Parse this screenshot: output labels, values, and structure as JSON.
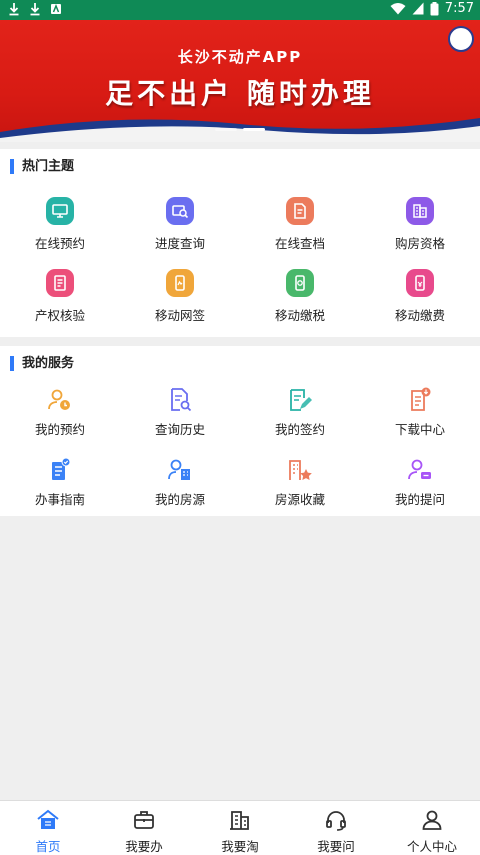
{
  "status_bar": {
    "time": "7:57"
  },
  "banner": {
    "subtitle": "长沙不动产APP",
    "title": "足不出户  随时办理"
  },
  "hot_topics": {
    "title": "热门主题",
    "items": [
      {
        "label": "在线预约",
        "icon": "calendar-screen-icon",
        "color": "#27b3a6"
      },
      {
        "label": "进度查询",
        "icon": "search-progress-icon",
        "color": "#6a6ef0"
      },
      {
        "label": "在线查档",
        "icon": "document-search-icon",
        "color": "#ec7b5c"
      },
      {
        "label": "购房资格",
        "icon": "building-qualification-icon",
        "color": "#8d5ae8"
      },
      {
        "label": "产权核验",
        "icon": "property-verify-icon",
        "color": "#ec4f7a"
      },
      {
        "label": "移动网签",
        "icon": "mobile-sign-icon",
        "color": "#f0a63a"
      },
      {
        "label": "移动缴税",
        "icon": "mobile-tax-icon",
        "color": "#49b86b"
      },
      {
        "label": "移动缴费",
        "icon": "mobile-payment-icon",
        "color": "#e84a8c"
      }
    ]
  },
  "my_services": {
    "title": "我的服务",
    "items": [
      {
        "label": "我的预约",
        "icon": "user-clock-icon",
        "color": "#f0a63a"
      },
      {
        "label": "查询历史",
        "icon": "document-search-icon",
        "color": "#6a6ef0"
      },
      {
        "label": "我的签约",
        "icon": "contract-edit-icon",
        "color": "#27b3a6"
      },
      {
        "label": "下载中心",
        "icon": "download-document-icon",
        "color": "#ec7b5c"
      },
      {
        "label": "办事指南",
        "icon": "guide-book-icon",
        "color": "#3b82f6"
      },
      {
        "label": "我的房源",
        "icon": "user-building-icon",
        "color": "#3b82f6"
      },
      {
        "label": "房源收藏",
        "icon": "building-star-icon",
        "color": "#ec7b5c"
      },
      {
        "label": "我的提问",
        "icon": "user-question-icon",
        "color": "#a855f7"
      }
    ]
  },
  "bottom_nav": {
    "active_color": "#2f7af8",
    "items": [
      {
        "label": "首页",
        "icon": "home-icon",
        "active": true
      },
      {
        "label": "我要办",
        "icon": "briefcase-icon",
        "active": false
      },
      {
        "label": "我要淘",
        "icon": "building-list-icon",
        "active": false
      },
      {
        "label": "我要问",
        "icon": "headset-icon",
        "active": false
      },
      {
        "label": "个人中心",
        "icon": "user-icon",
        "active": false
      }
    ]
  }
}
